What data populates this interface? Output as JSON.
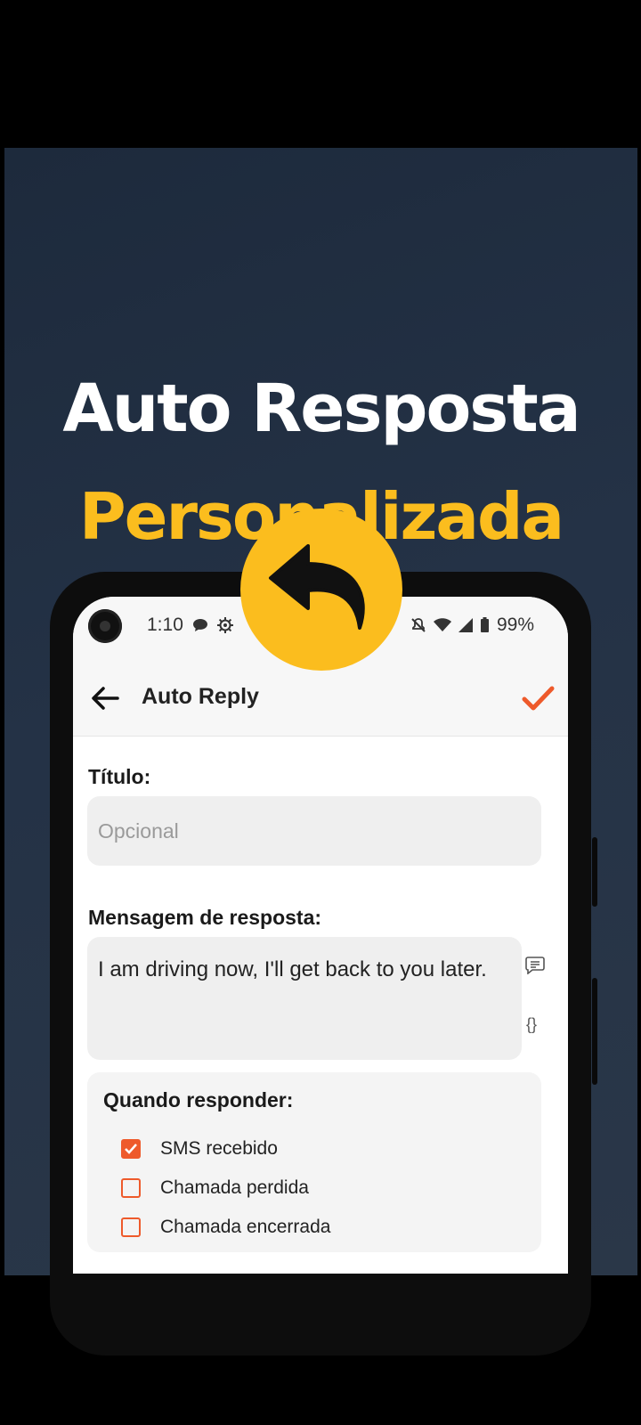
{
  "headline": {
    "line1": "Auto Resposta",
    "line2": "Personalizada"
  },
  "status_bar": {
    "time": "1:10",
    "battery": "99%"
  },
  "app_bar": {
    "title": "Auto Reply"
  },
  "form": {
    "title_label": "Título:",
    "title_placeholder": "Opcional",
    "message_label": "Mensagem de resposta:",
    "message_value": "I am driving now, I'll get back to you later.",
    "message_side_icon_2": "{}"
  },
  "when": {
    "title": "Quando responder:",
    "options": [
      {
        "label": "SMS recebido",
        "checked": true
      },
      {
        "label": "Chamada perdida",
        "checked": false
      },
      {
        "label": "Chamada encerrada",
        "checked": false
      }
    ]
  },
  "colors": {
    "accent": "#ee5a2b",
    "brand_yellow": "#fbbd1e",
    "background": "#1f2c3e"
  },
  "icons": [
    "reply-arrow-icon",
    "back-arrow-icon",
    "check-icon",
    "chat-bubble-icon",
    "settings-icon",
    "mute-icon",
    "wifi-icon",
    "signal-icon",
    "battery-icon",
    "message-template-icon",
    "variables-icon"
  ]
}
